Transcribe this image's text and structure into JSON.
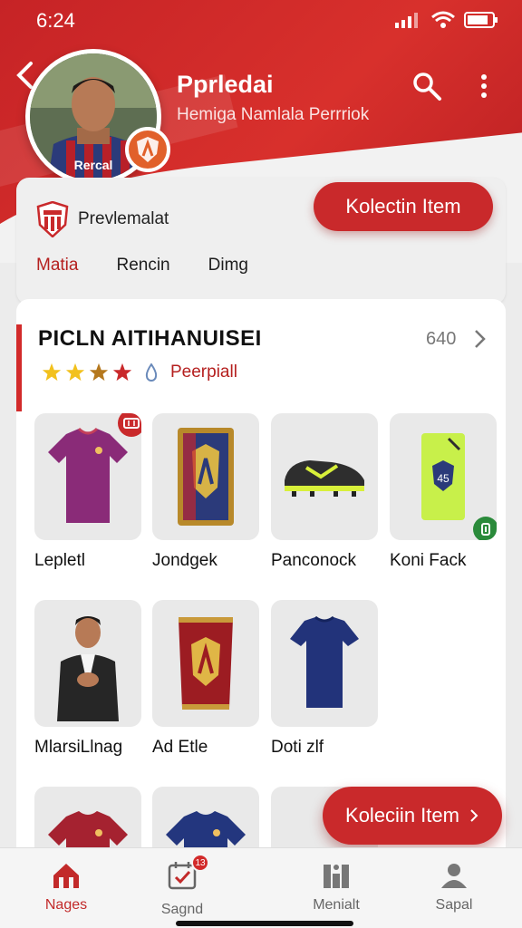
{
  "status_bar": {
    "time": "6:24"
  },
  "profile": {
    "name": "Pprledai",
    "subtitle": "Hemiga Namlala Perrriok",
    "team_label": "Prevlemalat",
    "collect_button": "Kolectin Item"
  },
  "tabs": [
    {
      "label": "Matia",
      "active": true
    },
    {
      "label": "Rencin",
      "active": false
    },
    {
      "label": "Dimg",
      "active": false
    }
  ],
  "section": {
    "title": "PICLN AITIHANUISEI",
    "count": "640",
    "rating_stars": 4,
    "rating_label": "Peerpiall"
  },
  "items": [
    {
      "label": "Lepletl",
      "icon": "purple-jersey-icon"
    },
    {
      "label": "Jondgek",
      "icon": "card-pack-icon"
    },
    {
      "label": "Panconock",
      "icon": "football-boot-icon"
    },
    {
      "label": "Koni Fack",
      "icon": "green-kit-icon"
    },
    {
      "label": "MlarsiLlnag",
      "icon": "player-figure-icon"
    },
    {
      "label": "Ad Etle",
      "icon": "red-pack-icon"
    },
    {
      "label": "Doti zlf",
      "icon": "blue-shirt-icon"
    }
  ],
  "fab": {
    "label": "Koleciin Item"
  },
  "bottom_nav": [
    {
      "label": "Nages",
      "icon": "home-icon",
      "active": true
    },
    {
      "label": "Sagnd",
      "icon": "calendar-check-icon",
      "badge": "13"
    },
    {
      "label": "Menialt",
      "icon": "stats-icon"
    },
    {
      "label": "Sapal",
      "icon": "profile-icon"
    }
  ],
  "colors": {
    "accent": "#c9292b",
    "accent_text": "#b5201f",
    "background": "#ececec"
  }
}
